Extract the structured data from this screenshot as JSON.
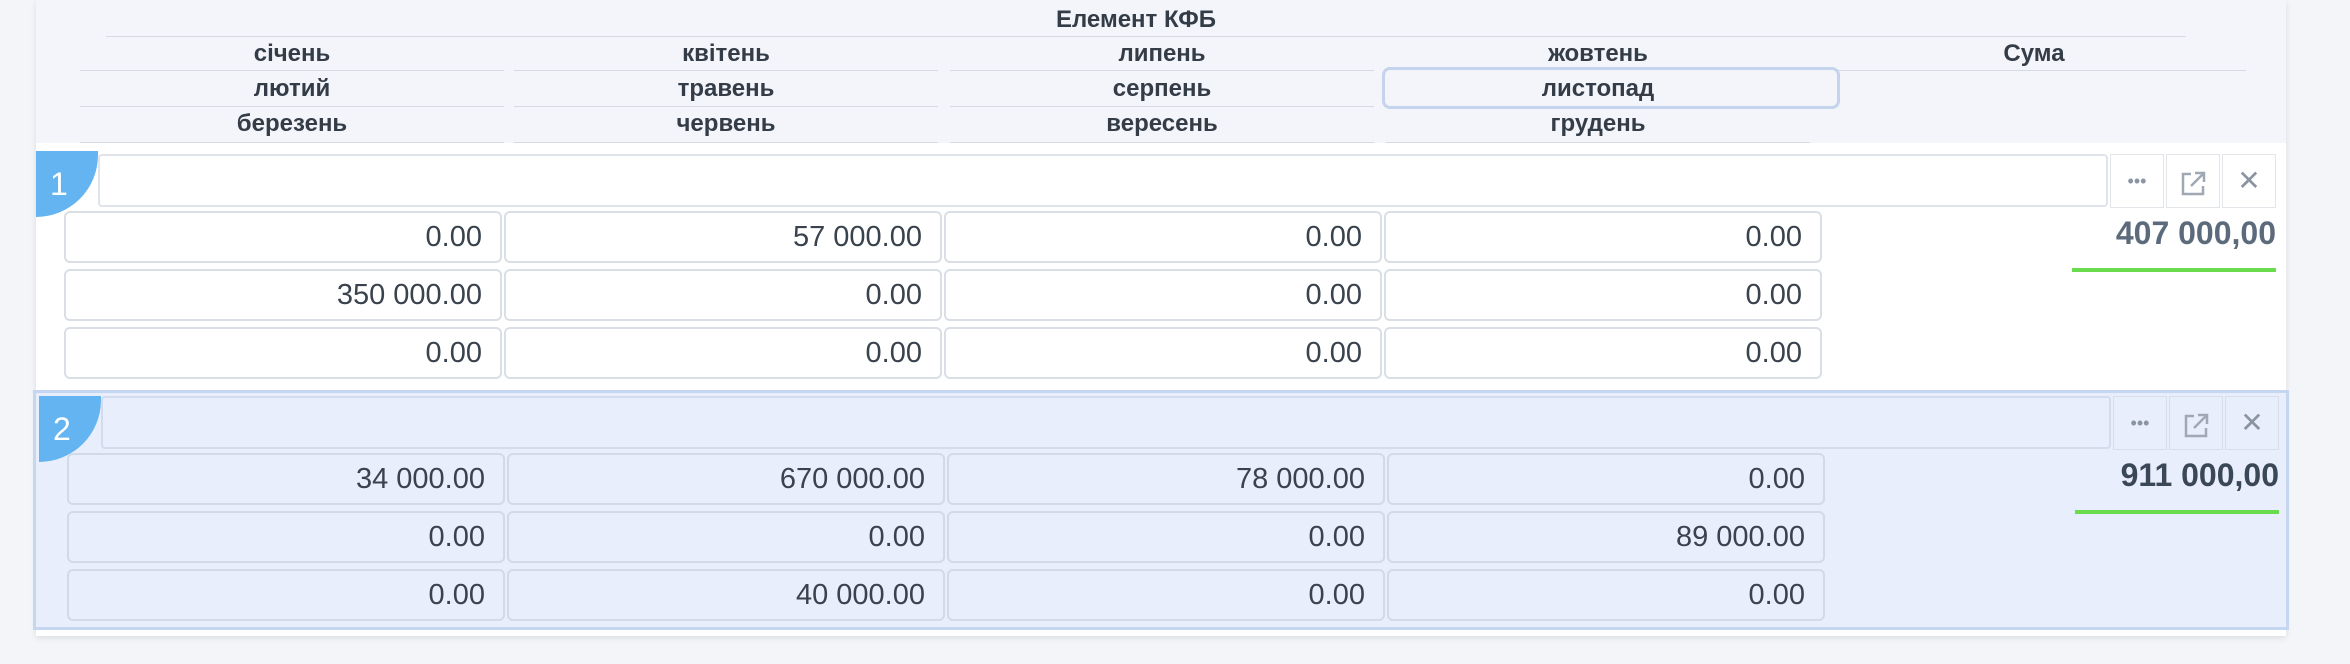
{
  "header": {
    "title": "Елемент КФБ",
    "sum_label": "Сума",
    "months": [
      [
        "січень",
        "квітень",
        "липень",
        "жовтень"
      ],
      [
        "лютий",
        "травень",
        "серпень",
        "листопад"
      ],
      [
        "березень",
        "червень",
        "вересень",
        "грудень"
      ]
    ]
  },
  "toolbar": {
    "more": "•••",
    "close": "✕"
  },
  "records": [
    {
      "index": "1",
      "name": "",
      "values": [
        [
          "0.00",
          "57 000.00",
          "0.00",
          "0.00"
        ],
        [
          "350 000.00",
          "0.00",
          "0.00",
          "0.00"
        ],
        [
          "0.00",
          "0.00",
          "0.00",
          "0.00"
        ]
      ],
      "sum": "407 000,00",
      "selected": false
    },
    {
      "index": "2",
      "name": "",
      "values": [
        [
          "34 000.00",
          "670 000.00",
          "78 000.00",
          "0.00"
        ],
        [
          "0.00",
          "0.00",
          "0.00",
          "89 000.00"
        ],
        [
          "0.00",
          "40 000.00",
          "0.00",
          "0.00"
        ]
      ],
      "sum": "911 000,00",
      "selected": true
    }
  ],
  "colors": {
    "badge": "#63b4f1",
    "sum_underline": "#6adb4c",
    "selected_row": "#e8eefb"
  }
}
